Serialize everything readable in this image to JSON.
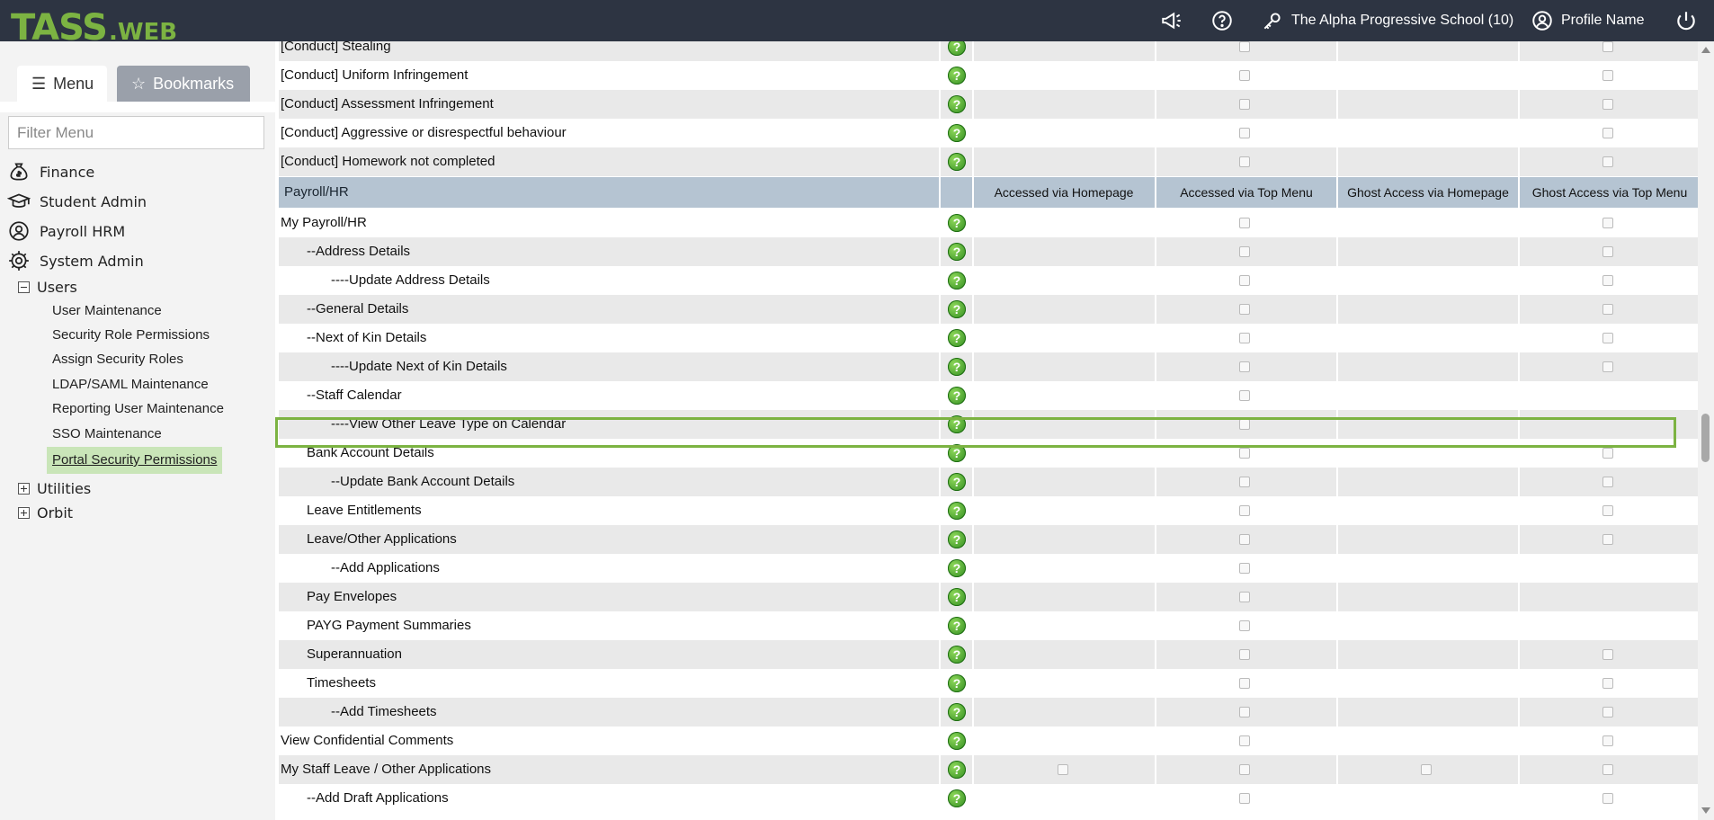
{
  "header": {
    "logo_main": "TASS",
    "logo_suffix": ".WEB",
    "school": "The Alpha Progressive School (10)",
    "profile": "Profile Name"
  },
  "sidebar": {
    "tab_menu": "Menu",
    "tab_bookmarks": "Bookmarks",
    "filter_placeholder": "Filter Menu",
    "top_items": [
      "Finance",
      "Student Admin",
      "Payroll HRM",
      "System Admin"
    ],
    "users_label": "Users",
    "users_children": [
      "User Maintenance",
      "Security Role Permissions",
      "Assign Security Roles",
      "LDAP/SAML Maintenance",
      "Reporting User Maintenance",
      "SSO Maintenance",
      "Portal Security Permissions"
    ],
    "active_item": "Portal Security Permissions",
    "collapsed": [
      "Utilities",
      "Orbit"
    ]
  },
  "table": {
    "section_header": "Payroll/HR",
    "columns": [
      "Accessed via Homepage",
      "Accessed via Top Menu",
      "Ghost Access via Homepage",
      "Ghost Access via Top Menu"
    ],
    "rows_before": [
      "[Conduct] Stealing",
      "[Conduct] Uniform Infringement",
      "[Conduct] Assessment Infringement",
      "[Conduct] Aggressive or disrespectful behaviour",
      "[Conduct] Homework not completed"
    ],
    "rows_after": [
      "My Payroll/HR",
      "--Address Details",
      "----Update Address Details",
      "--General Details",
      "--Next of Kin Details",
      "----Update Next of Kin Details",
      "--Staff Calendar",
      "----View Other Leave Type on Calendar",
      "Bank Account Details",
      "--Update Bank Account Details",
      "Leave Entitlements",
      "Leave/Other Applications",
      "--Add Applications",
      "Pay Envelopes",
      "PAYG Payment Summaries",
      "Superannuation",
      "Timesheets",
      "--Add Timesheets",
      "View Confidential Comments",
      "My Staff Leave / Other Applications",
      "--Add Draft Applications"
    ],
    "help_icon": "?",
    "highlighted_row": "----View Other Leave Type on Calendar"
  },
  "colors": {
    "topbar": "#2d3442",
    "brand_green": "#7cb342",
    "header_row": "#b5c4d2",
    "active_nav": "#c9e5b8"
  }
}
